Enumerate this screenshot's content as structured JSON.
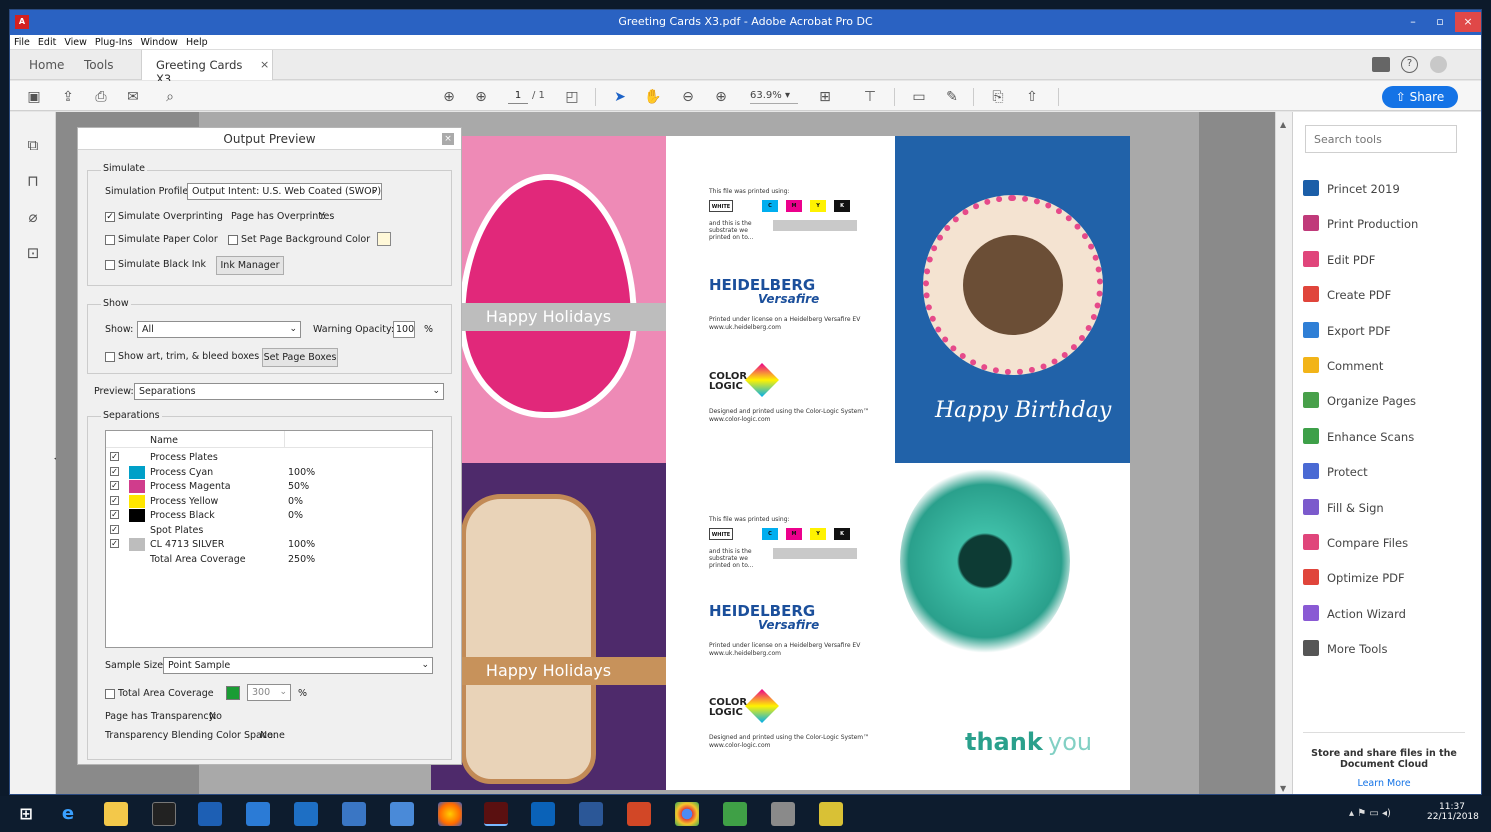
{
  "window": {
    "title": "Greeting Cards X3.pdf - Adobe Acrobat Pro DC"
  },
  "menu": [
    "File",
    "Edit",
    "View",
    "Plug-Ins",
    "Window",
    "Help"
  ],
  "tabs": {
    "home": "Home",
    "tools": "Tools",
    "doc": "Greeting Cards X3...",
    "close": "×"
  },
  "toolbar": {
    "page_current": "1",
    "page_total": "/ 1",
    "zoom": "63.9%",
    "share": "Share"
  },
  "dialog": {
    "title": "Output Preview",
    "simulate_label": "Simulate",
    "sim_profile_label": "Simulation Profile:",
    "sim_profile_value": "Output Intent: U.S. Web Coated (SWOP) v2",
    "sim_overprint": "Simulate Overprinting",
    "page_has_overprint": "Page has Overprint:",
    "page_has_overprint_value": "Yes",
    "sim_paper": "Simulate Paper Color",
    "set_page_bg": "Set Page Background Color",
    "sim_black": "Simulate Black Ink",
    "ink_manager": "Ink Manager",
    "show_label": "Show",
    "show_field_label": "Show:",
    "show_value": "All",
    "warning_opacity_label": "Warning Opacity:",
    "warning_opacity_value": "100",
    "percent": "%",
    "show_art": "Show art, trim, & bleed boxes",
    "set_page_boxes": "Set Page Boxes",
    "preview_label": "Preview:",
    "preview_value": "Separations",
    "separations_label": "Separations",
    "name_header": "Name",
    "rows": [
      {
        "name": "Process Plates",
        "value": "",
        "color": ""
      },
      {
        "name": "Process Cyan",
        "value": "100%",
        "color": "#00a0c8"
      },
      {
        "name": "Process Magenta",
        "value": "50%",
        "color": "#d03c8c"
      },
      {
        "name": "Process Yellow",
        "value": "0%",
        "color": "#ffe600"
      },
      {
        "name": "Process Black",
        "value": "0%",
        "color": "#000000"
      },
      {
        "name": "Spot Plates",
        "value": "",
        "color": ""
      },
      {
        "name": "CL 4713 SILVER",
        "value": "100%",
        "color": "#bdbdbd"
      },
      {
        "name": "Total Area Coverage",
        "value": "250%",
        "color": ""
      }
    ],
    "sample_size_label": "Sample Size:",
    "sample_size_value": "Point Sample",
    "tac_label": "Total Area Coverage",
    "tac_value": "300",
    "page_transparency": "Page has Transparency:",
    "page_transparency_value": "No",
    "blend_space": "Transparency Blending Color Space:",
    "blend_space_value": "None"
  },
  "cards": {
    "happy_holidays_1": "Happy Holidays",
    "happy_holidays_2": "Happy Holidays",
    "happy_birthday": "Happy Birthday",
    "thank": "thank",
    "you": "you",
    "printed_using": "This file was printed using:",
    "white": "WHITE",
    "c": "C",
    "m": "M",
    "y": "Y",
    "k": "K",
    "substrate": "and this is the substrate we printed on to...",
    "heidelberg": "HEIDELBERG",
    "versafire": "Versafire",
    "licence": "Printed under license on a Heidelberg Versafire EV",
    "licence_url": "www.uk.heidelberg.com",
    "color_logic_1": "COLOR",
    "color_logic_2": "LOGIC",
    "designed": "Designed and printed using the Color-Logic System™",
    "designed_url": "www.color-logic.com"
  },
  "right_panel": {
    "search_placeholder": "Search tools",
    "tools": [
      {
        "label": "Princet 2019",
        "color": "#1b5ea8"
      },
      {
        "label": "Print Production",
        "color": "#c03a7a"
      },
      {
        "label": "Edit PDF",
        "color": "#e0457b"
      },
      {
        "label": "Create PDF",
        "color": "#e0453b"
      },
      {
        "label": "Export PDF",
        "color": "#2f7fd6"
      },
      {
        "label": "Comment",
        "color": "#f2b418"
      },
      {
        "label": "Organize Pages",
        "color": "#48a04a"
      },
      {
        "label": "Enhance Scans",
        "color": "#3ea049"
      },
      {
        "label": "Protect",
        "color": "#4a6ad4"
      },
      {
        "label": "Fill & Sign",
        "color": "#7b5acc"
      },
      {
        "label": "Compare Files",
        "color": "#e0457b"
      },
      {
        "label": "Optimize PDF",
        "color": "#e0453b"
      },
      {
        "label": "Action Wizard",
        "color": "#8a5ad4"
      },
      {
        "label": "More Tools",
        "color": "#555555"
      }
    ],
    "cloud_text": "Store and share files in the Document Cloud",
    "learn_more": "Learn More"
  },
  "taskbar": {
    "time": "11:37",
    "date": "22/11/2018"
  }
}
